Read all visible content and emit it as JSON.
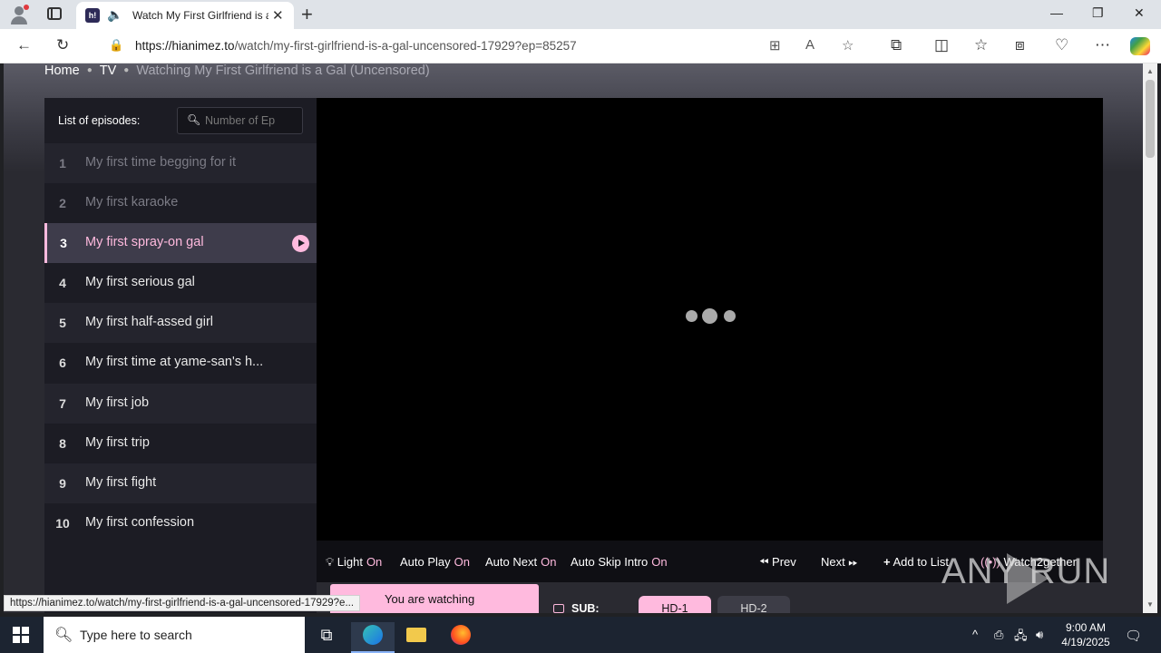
{
  "browser": {
    "tab_title": "Watch My First Girlfriend is a Gal (Uncensored)",
    "favicon_text": "h!",
    "url_host": "https://hianimez.to",
    "url_path": "/watch/my-first-girlfriend-is-a-gal-uncensored-17929?ep=85257",
    "status_url": "https://hianimez.to/watch/my-first-girlfriend-is-a-gal-uncensored-17929?e..."
  },
  "breadcrumb": {
    "home": "Home",
    "tv": "TV",
    "current": "Watching My First Girlfriend is a Gal (Uncensored)"
  },
  "episodes": {
    "header": "List of episodes:",
    "search_placeholder": "Number of Ep",
    "items": [
      {
        "num": "1",
        "title": "My first time begging for it"
      },
      {
        "num": "2",
        "title": "My first karaoke"
      },
      {
        "num": "3",
        "title": "My first spray-on gal"
      },
      {
        "num": "4",
        "title": "My first serious gal"
      },
      {
        "num": "5",
        "title": "My first half-assed girl"
      },
      {
        "num": "6",
        "title": "My first time at yame-san's h..."
      },
      {
        "num": "7",
        "title": "My first job"
      },
      {
        "num": "8",
        "title": "My first trip"
      },
      {
        "num": "9",
        "title": "My first fight"
      },
      {
        "num": "10",
        "title": "My first confession"
      }
    ]
  },
  "controls": {
    "light": "Light",
    "light_state": "On",
    "autoplay": "Auto Play",
    "autoplay_state": "On",
    "autonext": "Auto Next",
    "autonext_state": "On",
    "autoskip": "Auto Skip Intro",
    "autoskip_state": "On",
    "prev": "Prev",
    "next": "Next",
    "add_to_list": "Add to List",
    "watch2gether": "Watch2gether"
  },
  "servers": {
    "watching_text": "You are watching",
    "sub_label": "SUB:",
    "hd1": "HD-1",
    "hd2": "HD-2"
  },
  "watermark": "ANY RUN",
  "taskbar": {
    "search_placeholder": "Type here to search",
    "time": "9:00 AM",
    "date": "4/19/2025"
  },
  "colors": {
    "accent": "#ffbade",
    "page_bg": "#2a2a31",
    "list_bg": "#1c1c24"
  }
}
